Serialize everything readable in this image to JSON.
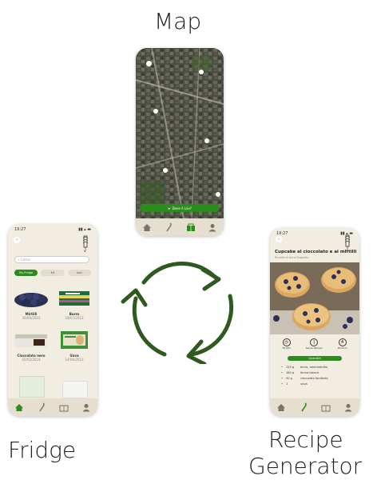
{
  "captions": {
    "map": "Map",
    "fridge": "Fridge",
    "recipe_line1": "Recipe",
    "recipe_line2": "Generator"
  },
  "colors": {
    "accent_green": "#2e8b1e",
    "dark_green_arrows": "#2f5a1f",
    "phone_bg": "#f2ede1",
    "navbar_bg": "#e6dfcf"
  },
  "map_screen": {
    "location_button": "Dove è Lov?",
    "pins": [
      {
        "icon": "pin-icon"
      },
      {
        "icon": "pin-icon"
      },
      {
        "icon": "pin-icon"
      },
      {
        "icon": "pin-icon"
      },
      {
        "icon": "pin-icon"
      },
      {
        "icon": "pin-icon"
      }
    ],
    "nav": [
      "home-icon",
      "spoon-icon",
      "fridge-icon",
      "user-icon"
    ]
  },
  "fridge_screen": {
    "time": "19:27",
    "search_placeholder": "Cerca",
    "tabs": [
      "My Fridge",
      "Kit",
      "Add"
    ],
    "items": [
      {
        "name": "Mirtilli",
        "date": "30/06/2023"
      },
      {
        "name": "Burro",
        "date": "18/07/2023"
      },
      {
        "name": "Cioccolato nero",
        "date": "02/02/2024"
      },
      {
        "name": "Uova",
        "date": "14/06/2023"
      }
    ],
    "nav": [
      "home-icon",
      "spoon-icon",
      "fridge-icon",
      "user-icon"
    ]
  },
  "recipe_screen": {
    "time": "19:27",
    "title": "Cupcake al cioccolato e ai mirtilli",
    "subtitle": "Ricetta di Anna Esposito",
    "stats": [
      {
        "icon": "clock-icon",
        "label": "30 Min"
      },
      {
        "icon": "thermometer-icon",
        "label": "Senza lattosio"
      },
      {
        "icon": "portion-icon",
        "value": "4",
        "label": "Porzioni"
      }
    ],
    "quantity_button": "Quantità",
    "ingredients": [
      {
        "qty": "125 g",
        "name": "burro, ammorbidito"
      },
      {
        "qty": "180 g",
        "name": "farina bianca"
      },
      {
        "qty": "50 g",
        "name": "cioccolato fondente"
      },
      {
        "qty": "1",
        "name": "uova"
      }
    ],
    "nav": [
      "home-icon",
      "spoon-icon",
      "fridge-icon",
      "user-icon"
    ]
  }
}
